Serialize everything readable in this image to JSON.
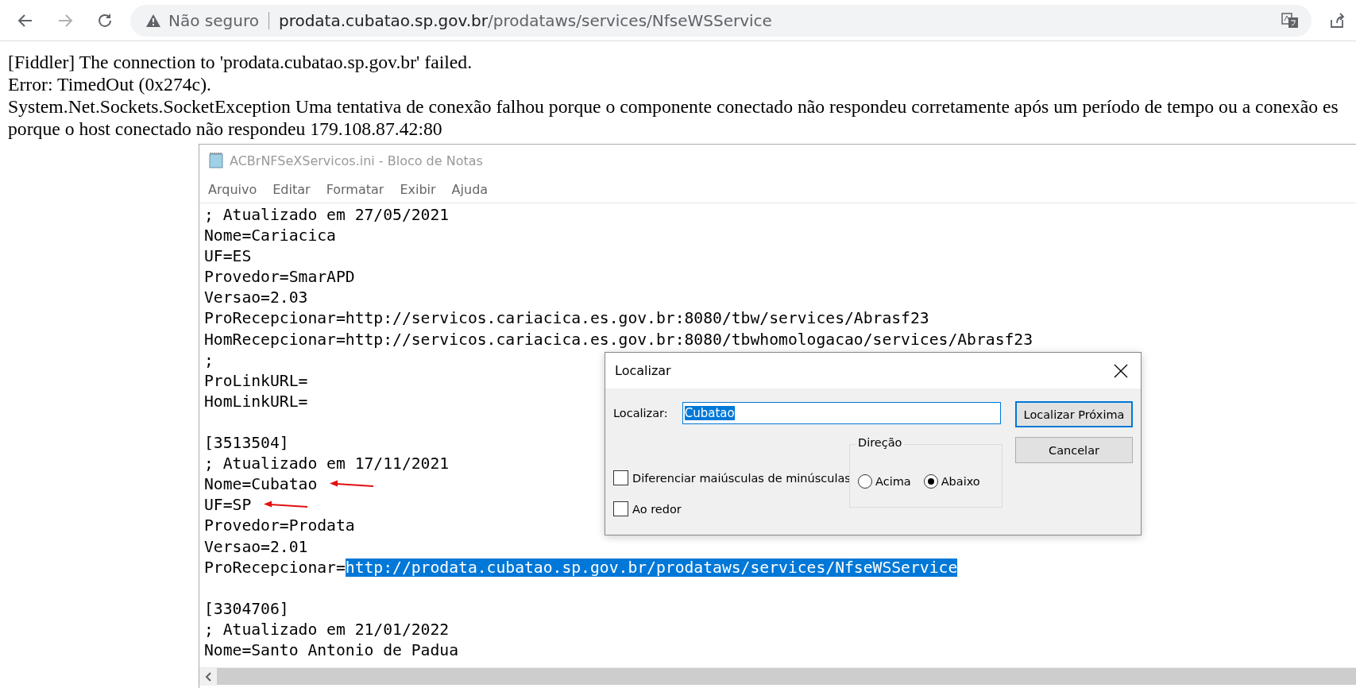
{
  "browser": {
    "security_label": "Não seguro",
    "url_host": "prodata.cubatao.sp.gov.br",
    "url_path": "/prodataws/services/NfseWSService"
  },
  "error_lines": [
    "[Fiddler] The connection to 'prodata.cubatao.sp.gov.br' failed.",
    "Error: TimedOut (0x274c).",
    "System.Net.Sockets.SocketException Uma tentativa de conexão falhou porque o componente conectado não respondeu corretamente após um período de tempo ou a conexão es",
    "porque o host conectado não respondeu 179.108.87.42:80"
  ],
  "notepad": {
    "title": "ACBrNFSeXServicos.ini - Bloco de Notas",
    "menu": [
      "Arquivo",
      "Editar",
      "Formatar",
      "Exibir",
      "Ajuda"
    ],
    "lines": [
      {
        "kind": "text",
        "text": "; Atualizado em 27/05/2021"
      },
      {
        "kind": "text",
        "text": "Nome=Cariacica"
      },
      {
        "kind": "text",
        "text": "UF=ES"
      },
      {
        "kind": "text",
        "text": "Provedor=SmarAPD"
      },
      {
        "kind": "text",
        "text": "Versao=2.03"
      },
      {
        "kind": "text",
        "text": "ProRecepcionar=http://servicos.cariacica.es.gov.br:8080/tbw/services/Abrasf23"
      },
      {
        "kind": "text",
        "text": "HomRecepcionar=http://servicos.cariacica.es.gov.br:8080/tbwhomologacao/services/Abrasf23"
      },
      {
        "kind": "text",
        "text": ";"
      },
      {
        "kind": "text",
        "text": "ProLinkURL="
      },
      {
        "kind": "text",
        "text": "HomLinkURL="
      },
      {
        "kind": "blank"
      },
      {
        "kind": "text",
        "text": "[3513504]"
      },
      {
        "kind": "text",
        "text": "; Atualizado em 17/11/2021"
      },
      {
        "kind": "text",
        "text": "Nome=Cubatao",
        "marked": true
      },
      {
        "kind": "text",
        "text": "UF=SP",
        "marked": true
      },
      {
        "kind": "text",
        "text": "Provedor=Prodata"
      },
      {
        "kind": "text",
        "text": "Versao=2.01"
      },
      {
        "kind": "text",
        "text": "ProRecepcionar=",
        "selection": "http://prodata.cubatao.sp.gov.br/prodataws/services/NfseWSService"
      },
      {
        "kind": "blank"
      },
      {
        "kind": "text",
        "text": "[3304706]"
      },
      {
        "kind": "text",
        "text": "; Atualizado em 21/01/2022"
      },
      {
        "kind": "text",
        "text": "Nome=Santo Antonio de Padua"
      }
    ]
  },
  "find_dialog": {
    "title": "Localizar",
    "find_label": "Localizar:",
    "find_value": "Cubatao",
    "direction_label": "Direção",
    "directions": [
      {
        "label": "Acima",
        "selected": false
      },
      {
        "label": "Abaixo",
        "selected": true
      }
    ],
    "options": [
      {
        "label": "Diferenciar maiúsculas de minúsculas",
        "checked": false
      },
      {
        "label": "Ao redor",
        "checked": false
      }
    ],
    "buttons": [
      {
        "label": "Localizar Próxima",
        "focused": true
      },
      {
        "label": "Cancelar",
        "focused": false
      }
    ]
  }
}
